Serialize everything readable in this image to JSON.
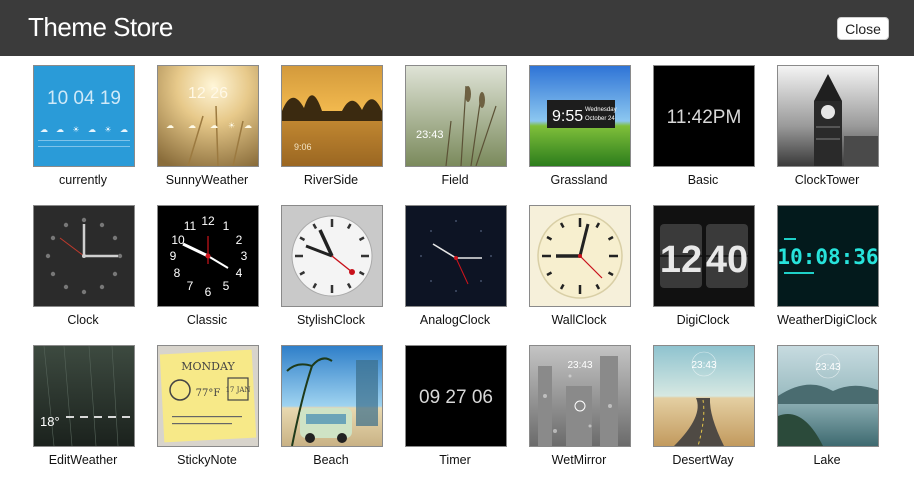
{
  "header": {
    "title": "Theme Store",
    "close_label": "Close"
  },
  "themes": [
    {
      "name": "currently",
      "time": "10 04 19",
      "weather": [
        "☁",
        "☁",
        "☀",
        "☁",
        "☀",
        "☁"
      ]
    },
    {
      "name": "SunnyWeather",
      "time": "12 26"
    },
    {
      "name": "RiverSide",
      "time": "9:06"
    },
    {
      "name": "Field",
      "time": "23:43"
    },
    {
      "name": "Grassland",
      "time": "9:55",
      "day": "Wednesday",
      "date": "October 24"
    },
    {
      "name": "Basic",
      "time": "11:42PM"
    },
    {
      "name": "ClockTower"
    },
    {
      "name": "Clock"
    },
    {
      "name": "Classic",
      "dial": [
        "12",
        "1",
        "2",
        "3",
        "4",
        "5",
        "6",
        "7",
        "8",
        "9",
        "10",
        "11"
      ]
    },
    {
      "name": "StylishClock"
    },
    {
      "name": "AnalogClock"
    },
    {
      "name": "WallClock"
    },
    {
      "name": "DigiClock",
      "hours": "12",
      "minutes": "40"
    },
    {
      "name": "WeatherDigiClock",
      "time": "10:08:36"
    },
    {
      "name": "EditWeather",
      "temp": "18°"
    },
    {
      "name": "StickyNote",
      "day": "MONDAY",
      "temp": "77°F",
      "date": "17 JAN"
    },
    {
      "name": "Beach"
    },
    {
      "name": "Timer",
      "time": "09 27 06"
    },
    {
      "name": "WetMirror",
      "time": "23:43"
    },
    {
      "name": "DesertWay",
      "time": "23:43"
    },
    {
      "name": "Lake",
      "time": "23:43"
    }
  ]
}
